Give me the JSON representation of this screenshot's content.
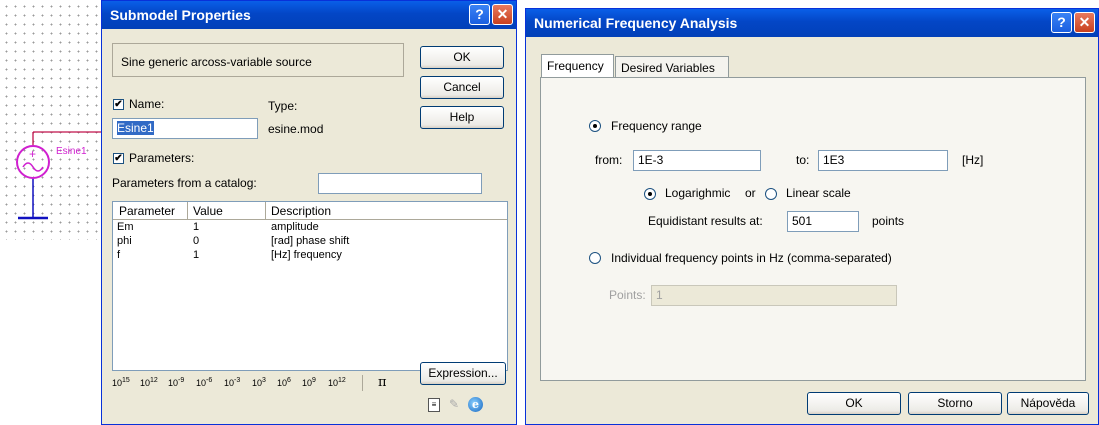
{
  "schematic": {
    "component_label": "Esine1"
  },
  "submodel": {
    "title": "Submodel Properties",
    "description": "Sine generic arcoss-variable source",
    "ok": "OK",
    "cancel": "Cancel",
    "help": "Help",
    "name_label": "Name:",
    "type_label": "Type:",
    "name_value": "Esine1",
    "type_value": "esine.mod",
    "parameters_label": "Parameters:",
    "catalog_label": "Parameters from a catalog:",
    "catalog_value": "",
    "table": {
      "headers": [
        "Parameter",
        "Value",
        "Description"
      ],
      "rows": [
        {
          "param": "Em",
          "value": "1",
          "desc": "amplitude"
        },
        {
          "param": "phi",
          "value": "0",
          "desc": "[rad] phase shift"
        },
        {
          "param": "f",
          "value": "1",
          "desc": "[Hz] frequency"
        }
      ]
    },
    "powers": [
      {
        "base": "10",
        "exp": "15"
      },
      {
        "base": "10",
        "exp": "12"
      },
      {
        "base": "10",
        "exp": "-9"
      },
      {
        "base": "10",
        "exp": "-6"
      },
      {
        "base": "10",
        "exp": "-3"
      },
      {
        "base": "10",
        "exp": "3"
      },
      {
        "base": "10",
        "exp": "6"
      },
      {
        "base": "10",
        "exp": "9"
      },
      {
        "base": "10",
        "exp": "12"
      }
    ],
    "pi": "π",
    "expression": "Expression..."
  },
  "nfa": {
    "title": "Numerical Frequency Analysis",
    "tabs": [
      "Frequency",
      "Desired Variables"
    ],
    "frequency_range_label": "Frequency range",
    "from_label": "from:",
    "from_value": "1E-3",
    "to_label": "to:",
    "to_value": "1E3",
    "unit": "[Hz]",
    "log_label": "Logarighmic",
    "or_label": "or",
    "linear_label": "Linear scale",
    "equidistant_label": "Equidistant results at:",
    "points_value": "501",
    "points_label": "points",
    "individual_label": "Individual frequency points in Hz (comma-separated)",
    "points_field_label": "Points:",
    "points_field_value": "1",
    "ok": "OK",
    "storno": "Storno",
    "napoveda": "Nápověda"
  }
}
